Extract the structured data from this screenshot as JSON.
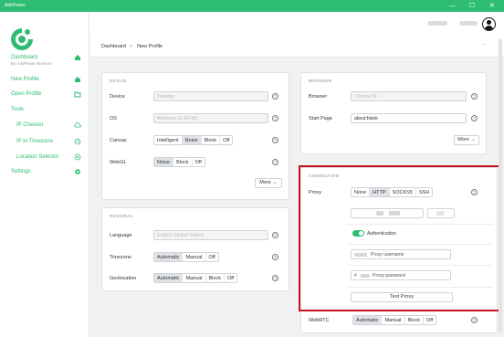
{
  "window": {
    "title": "AdsPower",
    "controls": [
      "—",
      "☐",
      "✕"
    ]
  },
  "sidebar": {
    "dashboard_label": "Dashboard",
    "dashboard_sub": "By AdsPower Browser",
    "items": [
      {
        "label": "New Profile",
        "icon": "home-icon"
      },
      {
        "label": "Open Profile",
        "icon": "folder-icon"
      },
      {
        "label": "Tools",
        "icon": ""
      },
      {
        "label": "IP Checker",
        "icon": "cloud-icon"
      },
      {
        "label": "IP to Timezone",
        "icon": "timezone-icon"
      },
      {
        "label": "Location Selector",
        "icon": "location-icon"
      },
      {
        "label": "Settings",
        "icon": "gear-icon"
      }
    ]
  },
  "breadcrumb": {
    "root": "Dashboard",
    "separator": "<",
    "current": "New Profile",
    "more": "···"
  },
  "device": {
    "title": "DEVICE",
    "device_label": "Device",
    "device_value": "Desktop",
    "os_label": "OS",
    "os_value": "Windows 10 (64-bit)",
    "canvas_label": "Canvas",
    "canvas_options": [
      "Intelligent",
      "Noise",
      "Block",
      "Off"
    ],
    "canvas_selected": "Noise",
    "webgl_label": "WebGL",
    "webgl_options": [
      "Noise",
      "Block",
      "Off"
    ],
    "webgl_selected": "Noise",
    "more_label": "More →"
  },
  "regional": {
    "title": "REGIONAL",
    "language_label": "Language",
    "language_value": "English (United States)",
    "timezone_label": "Timezone",
    "timezone_options": [
      "Automatic",
      "Manual",
      "Off"
    ],
    "timezone_selected": "Automatic",
    "geolocation_label": "Geolocation",
    "geolocation_options": [
      "Automatic",
      "Manual",
      "Block",
      "Off"
    ],
    "geolocation_selected": "Automatic"
  },
  "browser": {
    "title": "BROWSER",
    "browser_label": "Browser",
    "browser_value": "Chrome 94",
    "start_page_label": "Start Page",
    "start_page_value": "about:blank",
    "more_label": "More →"
  },
  "connection": {
    "title": "CONNECTION",
    "proxy_label": "Proxy",
    "proxy_options": [
      "None",
      "HTTP",
      "SOCKS5",
      "SSH"
    ],
    "proxy_selected": "HTTP",
    "authentication_label": "Authentication",
    "authentication_on": true,
    "username_placeholder": "Proxy username",
    "password_placeholder": "Proxy password",
    "password_prefix": "#",
    "test_proxy_label": "Test Proxy",
    "webrtc_label": "WebRTC",
    "webrtc_options": [
      "Automatic",
      "Manual",
      "Block",
      "Off"
    ],
    "webrtc_selected": "Automatic"
  },
  "colors": {
    "accent": "#2ebd72",
    "highlight_border": "#c8141e",
    "selected_segment": "#dfe2e6"
  }
}
